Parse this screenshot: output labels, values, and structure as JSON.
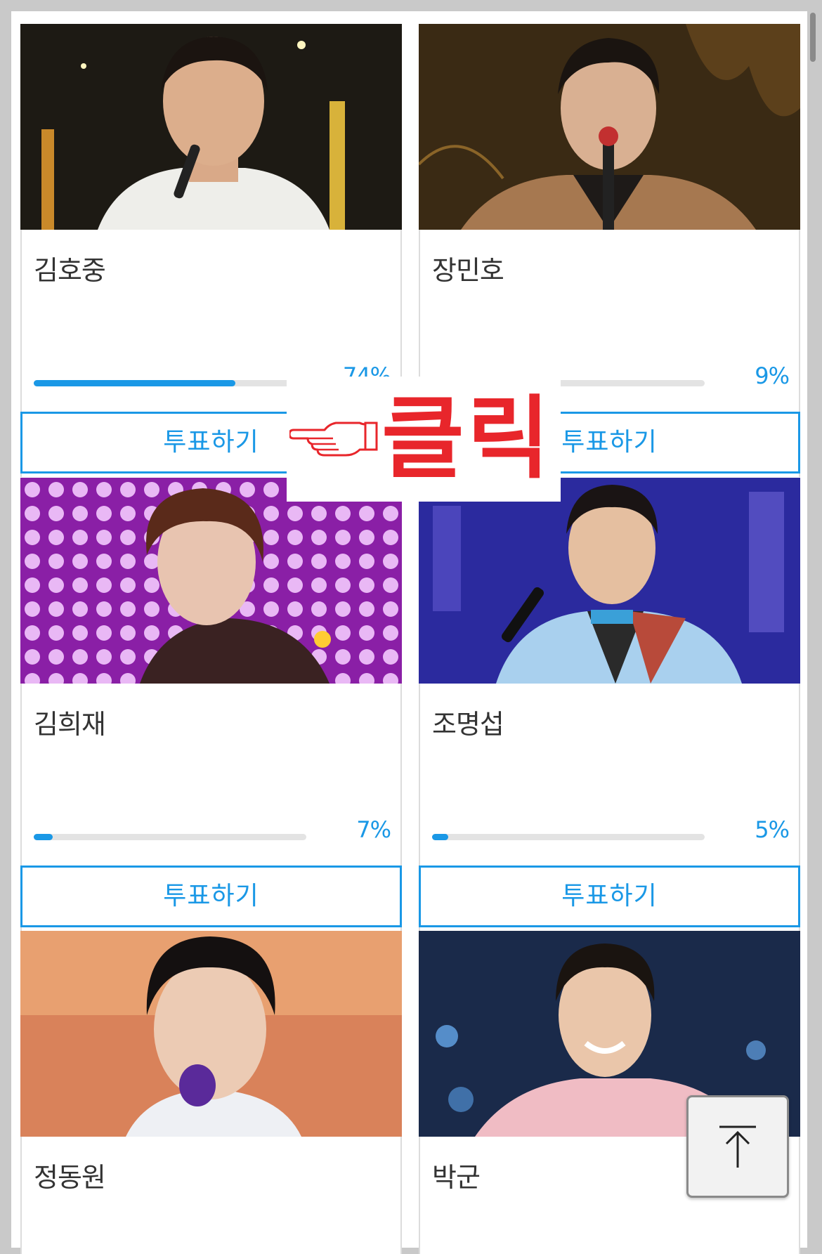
{
  "candidates": [
    {
      "name": "김호중",
      "percent": 74,
      "percent_label": "74%",
      "vote_label": "투표하기",
      "photo": "singer-photo-white-suit"
    },
    {
      "name": "장민호",
      "percent": 9,
      "percent_label": "9%",
      "vote_label": "투표하기",
      "photo": "singer-photo-brown-suit"
    },
    {
      "name": "김희재",
      "percent": 7,
      "percent_label": "7%",
      "vote_label": "투표하기",
      "photo": "singer-photo-purple-lights"
    },
    {
      "name": "조명섭",
      "percent": 5,
      "percent_label": "5%",
      "vote_label": "투표하기",
      "photo": "singer-photo-blue-stage"
    },
    {
      "name": "정동원",
      "photo": "singer-photo-orange-stage"
    },
    {
      "name": "박군",
      "photo": "singer-photo-pink-jacket"
    }
  ],
  "overlay": {
    "text": "클릭",
    "icon": "pointing-hand-icon"
  },
  "scroll_top": {
    "icon": "arrow-up-icon"
  },
  "colors": {
    "accent": "#1a98e6",
    "overlay_text": "#e8262b",
    "track": "#e3e3e3"
  }
}
